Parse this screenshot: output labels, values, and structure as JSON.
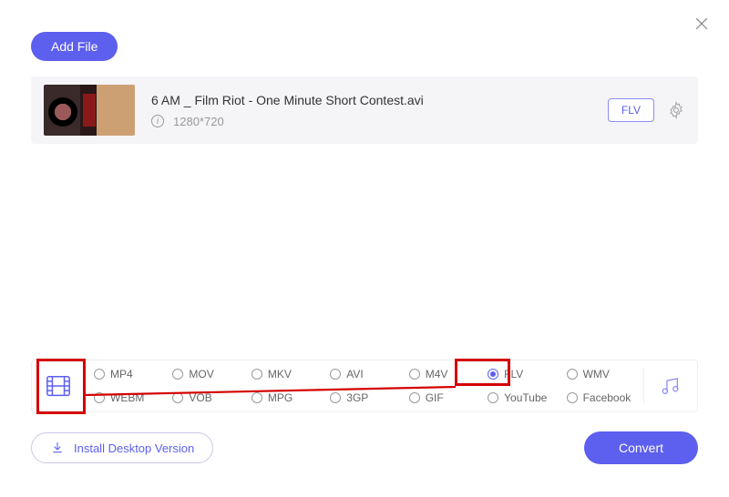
{
  "header": {
    "add_file_label": "Add File"
  },
  "file": {
    "title": "6 AM _ Film Riot - One Minute Short Contest.avi",
    "resolution": "1280*720",
    "format_tag": "FLV"
  },
  "formats": {
    "selected": "FLV",
    "row1": [
      "MP4",
      "MOV",
      "MKV",
      "AVI",
      "M4V",
      "FLV",
      "WMV"
    ],
    "row2": [
      "WEBM",
      "VOB",
      "MPG",
      "3GP",
      "GIF",
      "YouTube",
      "Facebook"
    ]
  },
  "footer": {
    "install_label": "Install Desktop Version",
    "convert_label": "Convert"
  }
}
